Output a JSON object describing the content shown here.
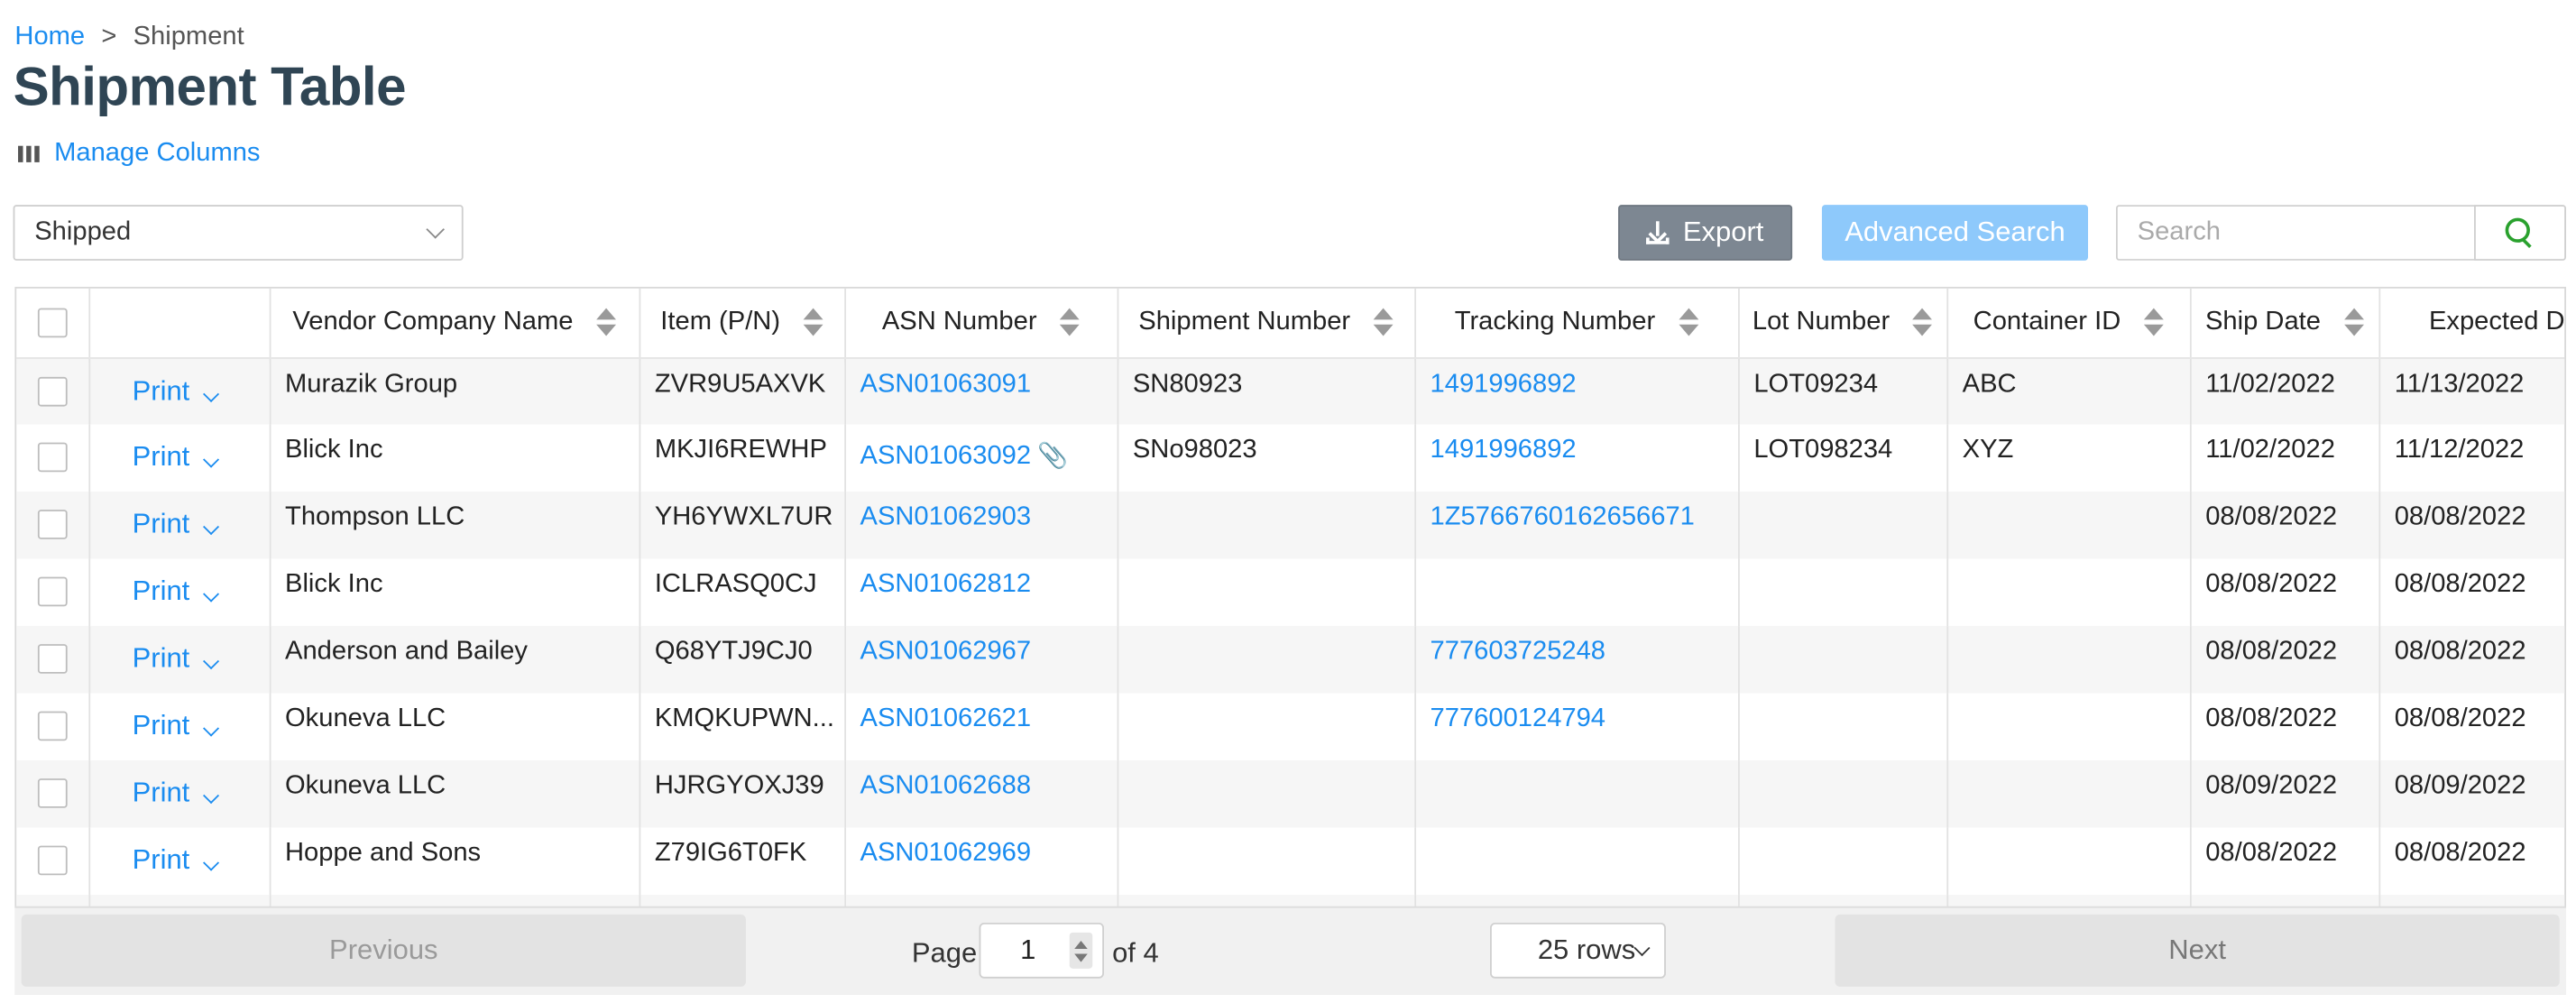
{
  "breadcrumb": {
    "home": "Home",
    "separator": ">",
    "current": "Shipment"
  },
  "page_title": "Shipment Table",
  "manage_columns": "Manage Columns",
  "filters": {
    "status_selected": "Shipped"
  },
  "toolbar": {
    "export_label": "Export",
    "advanced_search_label": "Advanced Search",
    "search_placeholder": "Search"
  },
  "table": {
    "columns": [
      "Vendor Company Name",
      "Item (P/N)",
      "ASN Number",
      "Shipment Number",
      "Tracking Number",
      "Lot Number",
      "Container ID",
      "Ship Date",
      "Expected D"
    ],
    "print_label": "Print",
    "rows": [
      {
        "vendor": "Murazik Group",
        "item": "ZVR9U5AXVK",
        "asn": "ASN01063091",
        "shipment": "SN80923",
        "tracking": "1491996892",
        "lot": "LOT09234",
        "container": "ABC",
        "ship_date": "11/02/2022",
        "expected": "11/13/2022",
        "attachment": false
      },
      {
        "vendor": "Blick Inc",
        "item": "MKJI6REWHP",
        "asn": "ASN01063092",
        "shipment": "SNo98023",
        "tracking": "1491996892",
        "lot": "LOT098234",
        "container": "XYZ",
        "ship_date": "11/02/2022",
        "expected": "11/12/2022",
        "attachment": true
      },
      {
        "vendor": "Thompson LLC",
        "item": "YH6YWXL7UR",
        "asn": "ASN01062903",
        "shipment": "",
        "tracking": "1Z5766760162656671",
        "lot": "",
        "container": "",
        "ship_date": "08/08/2022",
        "expected": "08/08/2022",
        "attachment": false
      },
      {
        "vendor": "Blick Inc",
        "item": "ICLRASQ0CJ",
        "asn": "ASN01062812",
        "shipment": "",
        "tracking": "",
        "lot": "",
        "container": "",
        "ship_date": "08/08/2022",
        "expected": "08/08/2022",
        "attachment": false
      },
      {
        "vendor": "Anderson and Bailey",
        "item": "Q68YTJ9CJ0",
        "asn": "ASN01062967",
        "shipment": "",
        "tracking": "777603725248",
        "lot": "",
        "container": "",
        "ship_date": "08/08/2022",
        "expected": "08/08/2022",
        "attachment": false
      },
      {
        "vendor": "Okuneva LLC",
        "item": "KMQKUPWN...",
        "asn": "ASN01062621",
        "shipment": "",
        "tracking": "777600124794",
        "lot": "",
        "container": "",
        "ship_date": "08/08/2022",
        "expected": "08/08/2022",
        "attachment": false
      },
      {
        "vendor": "Okuneva LLC",
        "item": "HJRGYOXJ39",
        "asn": "ASN01062688",
        "shipment": "",
        "tracking": "",
        "lot": "",
        "container": "",
        "ship_date": "08/09/2022",
        "expected": "08/09/2022",
        "attachment": false
      },
      {
        "vendor": "Hoppe and Sons",
        "item": "Z79IG6T0FK",
        "asn": "ASN01062969",
        "shipment": "",
        "tracking": "",
        "lot": "",
        "container": "",
        "ship_date": "08/08/2022",
        "expected": "08/08/2022",
        "attachment": false
      }
    ]
  },
  "pagination": {
    "previous": "Previous",
    "page_label": "Page",
    "current_page": "1",
    "of_label": "of 4",
    "rows_per_page": "25 rows",
    "next": "Next"
  },
  "colors": {
    "link": "#1a8cf0",
    "title": "#2f4554",
    "export_bg": "#7d8792",
    "advanced_bg": "#8ec9fb",
    "search_icon": "#2aa12e"
  },
  "icons": {
    "manage_columns": "columns-icon",
    "export": "download-icon",
    "search": "search-icon",
    "attachment": "paperclip-icon"
  }
}
